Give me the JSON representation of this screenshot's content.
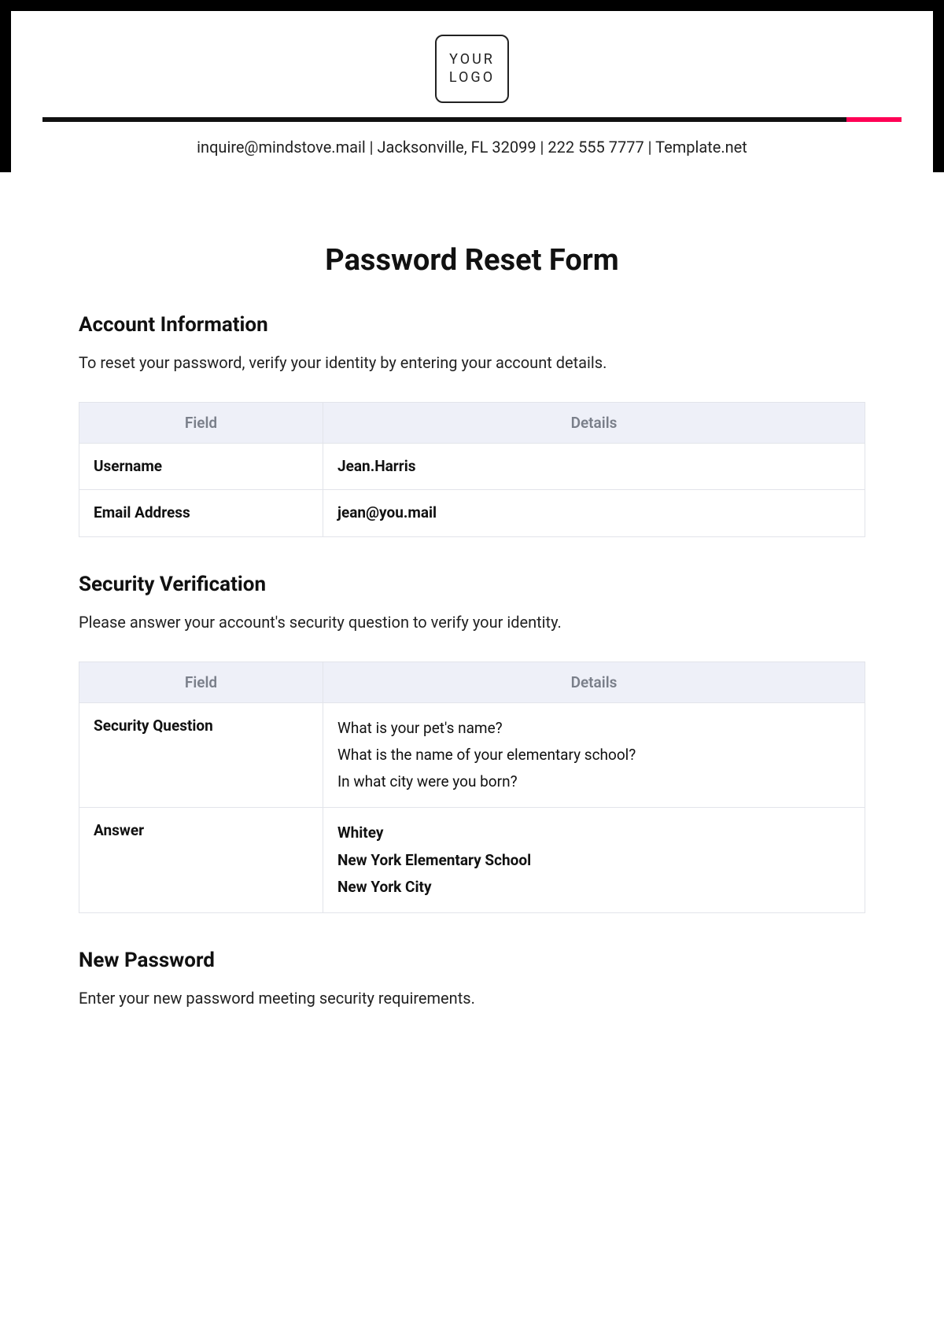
{
  "header": {
    "logo_line1": "YOUR",
    "logo_line2": "LOGO",
    "contact": "inquire@mindstove.mail | Jacksonville, FL 32099 | 222 555 7777 | Template.net"
  },
  "title": "Password Reset Form",
  "sections": {
    "account": {
      "heading": "Account Information",
      "description": "To reset your password, verify your identity by entering your account details.",
      "table": {
        "headers": {
          "field": "Field",
          "details": "Details"
        },
        "rows": [
          {
            "field": "Username",
            "value": "Jean.Harris"
          },
          {
            "field": "Email Address",
            "value": "jean@you.mail"
          }
        ]
      }
    },
    "security": {
      "heading": "Security Verification",
      "description": "Please answer your account's security question to verify your identity.",
      "table": {
        "headers": {
          "field": "Field",
          "details": "Details"
        },
        "rows": {
          "question": {
            "label": "Security Question",
            "lines": [
              "What is your pet's name?",
              "What is the name of your elementary school?",
              "In what city were you born?"
            ]
          },
          "answer": {
            "label": "Answer",
            "lines": [
              "Whitey",
              "New York Elementary School",
              "New York City"
            ]
          }
        }
      }
    },
    "newpass": {
      "heading": "New Password",
      "description": "Enter your new password meeting security requirements."
    }
  }
}
